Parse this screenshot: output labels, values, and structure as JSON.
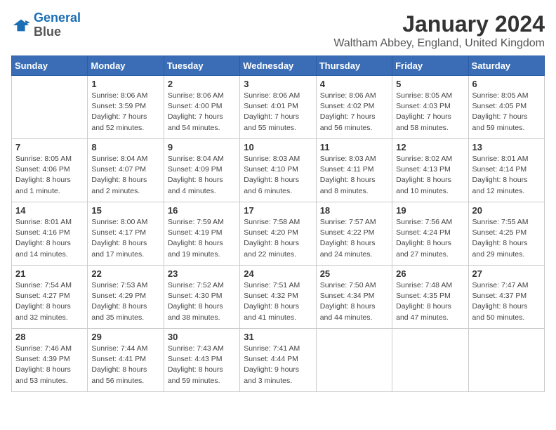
{
  "header": {
    "logo_line1": "General",
    "logo_line2": "Blue",
    "main_title": "January 2024",
    "subtitle": "Waltham Abbey, England, United Kingdom"
  },
  "calendar": {
    "days_of_week": [
      "Sunday",
      "Monday",
      "Tuesday",
      "Wednesday",
      "Thursday",
      "Friday",
      "Saturday"
    ],
    "weeks": [
      [
        {
          "number": "",
          "info": ""
        },
        {
          "number": "1",
          "info": "Sunrise: 8:06 AM\nSunset: 3:59 PM\nDaylight: 7 hours\nand 52 minutes."
        },
        {
          "number": "2",
          "info": "Sunrise: 8:06 AM\nSunset: 4:00 PM\nDaylight: 7 hours\nand 54 minutes."
        },
        {
          "number": "3",
          "info": "Sunrise: 8:06 AM\nSunset: 4:01 PM\nDaylight: 7 hours\nand 55 minutes."
        },
        {
          "number": "4",
          "info": "Sunrise: 8:06 AM\nSunset: 4:02 PM\nDaylight: 7 hours\nand 56 minutes."
        },
        {
          "number": "5",
          "info": "Sunrise: 8:05 AM\nSunset: 4:03 PM\nDaylight: 7 hours\nand 58 minutes."
        },
        {
          "number": "6",
          "info": "Sunrise: 8:05 AM\nSunset: 4:05 PM\nDaylight: 7 hours\nand 59 minutes."
        }
      ],
      [
        {
          "number": "7",
          "info": "Sunrise: 8:05 AM\nSunset: 4:06 PM\nDaylight: 8 hours\nand 1 minute."
        },
        {
          "number": "8",
          "info": "Sunrise: 8:04 AM\nSunset: 4:07 PM\nDaylight: 8 hours\nand 2 minutes."
        },
        {
          "number": "9",
          "info": "Sunrise: 8:04 AM\nSunset: 4:09 PM\nDaylight: 8 hours\nand 4 minutes."
        },
        {
          "number": "10",
          "info": "Sunrise: 8:03 AM\nSunset: 4:10 PM\nDaylight: 8 hours\nand 6 minutes."
        },
        {
          "number": "11",
          "info": "Sunrise: 8:03 AM\nSunset: 4:11 PM\nDaylight: 8 hours\nand 8 minutes."
        },
        {
          "number": "12",
          "info": "Sunrise: 8:02 AM\nSunset: 4:13 PM\nDaylight: 8 hours\nand 10 minutes."
        },
        {
          "number": "13",
          "info": "Sunrise: 8:01 AM\nSunset: 4:14 PM\nDaylight: 8 hours\nand 12 minutes."
        }
      ],
      [
        {
          "number": "14",
          "info": "Sunrise: 8:01 AM\nSunset: 4:16 PM\nDaylight: 8 hours\nand 14 minutes."
        },
        {
          "number": "15",
          "info": "Sunrise: 8:00 AM\nSunset: 4:17 PM\nDaylight: 8 hours\nand 17 minutes."
        },
        {
          "number": "16",
          "info": "Sunrise: 7:59 AM\nSunset: 4:19 PM\nDaylight: 8 hours\nand 19 minutes."
        },
        {
          "number": "17",
          "info": "Sunrise: 7:58 AM\nSunset: 4:20 PM\nDaylight: 8 hours\nand 22 minutes."
        },
        {
          "number": "18",
          "info": "Sunrise: 7:57 AM\nSunset: 4:22 PM\nDaylight: 8 hours\nand 24 minutes."
        },
        {
          "number": "19",
          "info": "Sunrise: 7:56 AM\nSunset: 4:24 PM\nDaylight: 8 hours\nand 27 minutes."
        },
        {
          "number": "20",
          "info": "Sunrise: 7:55 AM\nSunset: 4:25 PM\nDaylight: 8 hours\nand 29 minutes."
        }
      ],
      [
        {
          "number": "21",
          "info": "Sunrise: 7:54 AM\nSunset: 4:27 PM\nDaylight: 8 hours\nand 32 minutes."
        },
        {
          "number": "22",
          "info": "Sunrise: 7:53 AM\nSunset: 4:29 PM\nDaylight: 8 hours\nand 35 minutes."
        },
        {
          "number": "23",
          "info": "Sunrise: 7:52 AM\nSunset: 4:30 PM\nDaylight: 8 hours\nand 38 minutes."
        },
        {
          "number": "24",
          "info": "Sunrise: 7:51 AM\nSunset: 4:32 PM\nDaylight: 8 hours\nand 41 minutes."
        },
        {
          "number": "25",
          "info": "Sunrise: 7:50 AM\nSunset: 4:34 PM\nDaylight: 8 hours\nand 44 minutes."
        },
        {
          "number": "26",
          "info": "Sunrise: 7:48 AM\nSunset: 4:35 PM\nDaylight: 8 hours\nand 47 minutes."
        },
        {
          "number": "27",
          "info": "Sunrise: 7:47 AM\nSunset: 4:37 PM\nDaylight: 8 hours\nand 50 minutes."
        }
      ],
      [
        {
          "number": "28",
          "info": "Sunrise: 7:46 AM\nSunset: 4:39 PM\nDaylight: 8 hours\nand 53 minutes."
        },
        {
          "number": "29",
          "info": "Sunrise: 7:44 AM\nSunset: 4:41 PM\nDaylight: 8 hours\nand 56 minutes."
        },
        {
          "number": "30",
          "info": "Sunrise: 7:43 AM\nSunset: 4:43 PM\nDaylight: 8 hours\nand 59 minutes."
        },
        {
          "number": "31",
          "info": "Sunrise: 7:41 AM\nSunset: 4:44 PM\nDaylight: 9 hours\nand 3 minutes."
        },
        {
          "number": "",
          "info": ""
        },
        {
          "number": "",
          "info": ""
        },
        {
          "number": "",
          "info": ""
        }
      ]
    ]
  }
}
